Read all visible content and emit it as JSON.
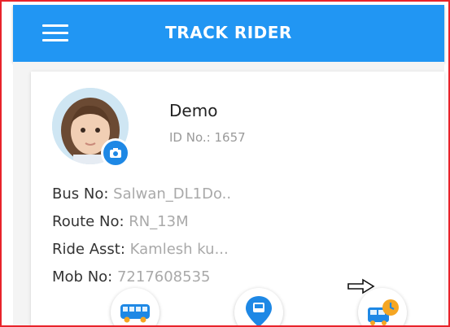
{
  "appbar": {
    "title": "TRACK RIDER"
  },
  "profile": {
    "name": "Demo",
    "id_label": "ID No.:",
    "id_value": "1657"
  },
  "details": [
    {
      "label": "Bus No:",
      "value": "Salwan_DL1Do.."
    },
    {
      "label": "Route No:",
      "value": "RN_13M"
    },
    {
      "label": "Ride Asst:",
      "value": "Kamlesh ku..."
    },
    {
      "label": "Mob No:",
      "value": "7217608535"
    }
  ],
  "actions": [
    {
      "icon": "bus-icon"
    },
    {
      "icon": "bus-stop-pin-icon"
    },
    {
      "icon": "bus-clock-icon"
    }
  ],
  "colors": {
    "primary": "#2196f3",
    "frame_border": "#e8232a",
    "label_text": "#333333",
    "value_text": "#a9a9a9",
    "icon_blue": "#1e88e5",
    "icon_orange": "#f5a623"
  }
}
